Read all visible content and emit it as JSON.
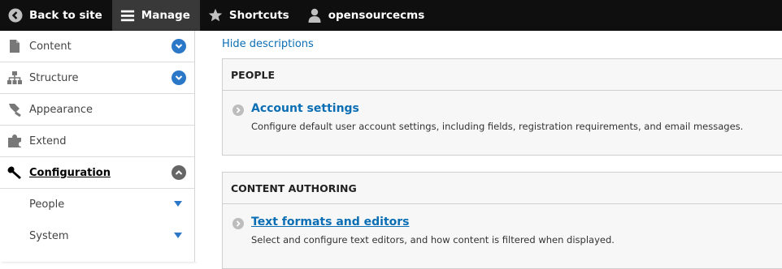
{
  "toolbar": {
    "back": {
      "label": "Back to site",
      "icon": "chevron-left-icon"
    },
    "manage": {
      "label": "Manage",
      "icon": "hamburger-icon"
    },
    "shortcuts": {
      "label": "Shortcuts",
      "icon": "star-icon"
    },
    "user": {
      "label": "opensourcecms",
      "icon": "user-icon"
    }
  },
  "sidebar": {
    "items": [
      {
        "label": "Content",
        "icon": "file-icon",
        "toggle": "chevron-down-icon"
      },
      {
        "label": "Structure",
        "icon": "structure-icon",
        "toggle": "chevron-down-icon"
      },
      {
        "label": "Appearance",
        "icon": "paint-icon"
      },
      {
        "label": "Extend",
        "icon": "puzzle-icon"
      },
      {
        "label": "Configuration",
        "icon": "wrench-icon",
        "toggle": "chevron-up-icon",
        "active": true
      }
    ],
    "subitems": [
      {
        "label": "People"
      },
      {
        "label": "System"
      }
    ]
  },
  "main": {
    "hide_descriptions": "Hide descriptions",
    "panels": [
      {
        "title": "PEOPLE",
        "entries": [
          {
            "title": "Account settings",
            "description": "Configure default user account settings, including fields, registration requirements, and email messages."
          }
        ]
      },
      {
        "title": "CONTENT AUTHORING",
        "entries": [
          {
            "title": "Text formats and editors",
            "description": "Select and configure text editors, and how content is filtered when displayed."
          }
        ]
      }
    ]
  },
  "colors": {
    "toolbar_bg": "#0f0f0f",
    "manage_active_bg": "#393939",
    "link": "#0a6eb4",
    "toggle_blue": "#2c78c8",
    "toggle_grey": "#666666"
  }
}
